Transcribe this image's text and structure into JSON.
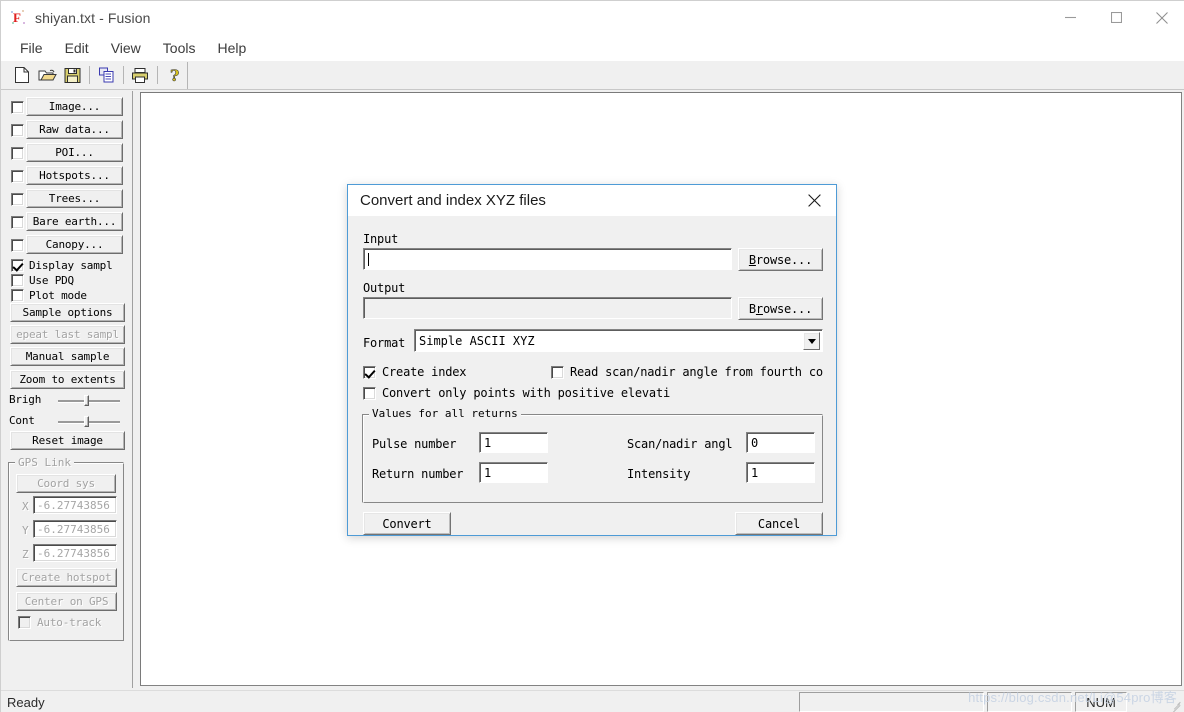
{
  "window": {
    "title": "shiyan.txt - Fusion",
    "icon": "fusion-app-icon",
    "controls": {
      "minimize": "minimize-icon",
      "maximize": "maximize-icon",
      "close": "close-icon"
    }
  },
  "menubar": {
    "items": [
      {
        "label": "File"
      },
      {
        "label": "Edit"
      },
      {
        "label": "View"
      },
      {
        "label": "Tools"
      },
      {
        "label": "Help"
      }
    ]
  },
  "toolbar": {
    "buttons": [
      {
        "icon": "new-file-icon",
        "title": "New"
      },
      {
        "icon": "open-folder-icon",
        "title": "Open"
      },
      {
        "icon": "save-floppy-icon",
        "title": "Save"
      },
      {
        "icon": "copy-icon",
        "title": "Copy"
      },
      {
        "icon": "print-icon",
        "title": "Print"
      },
      {
        "icon": "help-question-icon",
        "title": "About"
      }
    ]
  },
  "left_panel": {
    "layer_rows": [
      {
        "label": "Image...",
        "checked": false,
        "accel": "I"
      },
      {
        "label": "Raw data...",
        "checked": false,
        "accel": "d"
      },
      {
        "label": "POI...",
        "checked": false,
        "accel": "P"
      },
      {
        "label": "Hotspots...",
        "checked": false,
        "accel": "H"
      },
      {
        "label": "Trees...",
        "checked": false,
        "accel": "r"
      },
      {
        "label": "Bare earth...",
        "checked": false,
        "accel": "B"
      },
      {
        "label": "Canopy...",
        "checked": false,
        "accel": "C"
      }
    ],
    "checkboxes": [
      {
        "label": "Display sampl",
        "checked": true
      },
      {
        "label": "Use PDQ",
        "checked": false
      },
      {
        "label": "Plot mode",
        "checked": false
      }
    ],
    "buttons": [
      {
        "label": "Sample options",
        "disabled": false
      },
      {
        "label": "epeat last sampl",
        "disabled": true
      },
      {
        "label": "Manual sample",
        "disabled": false
      },
      {
        "label": "Zoom to extents",
        "disabled": false
      },
      {
        "label": "Reset image",
        "disabled": false
      }
    ],
    "sliders": [
      {
        "label": "Brigh",
        "value": 52
      },
      {
        "label": "Cont",
        "value": 52
      }
    ],
    "gps_group": {
      "title": "GPS Link",
      "coord_button": "Coord sys",
      "coords": [
        {
          "label": "X",
          "value": "-6.27743856"
        },
        {
          "label": "Y",
          "value": "-6.27743856"
        },
        {
          "label": "Z",
          "value": "-6.27743856"
        }
      ],
      "buttons": [
        {
          "label": "Create hotspot",
          "disabled": true
        },
        {
          "label": "Center on GPS",
          "disabled": true
        }
      ],
      "autotrack": {
        "label": "Auto-track",
        "checked": false,
        "disabled": true
      }
    }
  },
  "dialog": {
    "title": "Convert and index XYZ files",
    "close_icon": "close-icon",
    "input": {
      "label": "Input",
      "value": "",
      "browse": "Browse...",
      "browse_accel": "B"
    },
    "output": {
      "label": "Output",
      "value": "",
      "browse": "Browse...",
      "browse_accel": "r"
    },
    "format": {
      "label": "Format",
      "value": "Simple ASCII XYZ",
      "options": [
        "Simple ASCII XYZ"
      ]
    },
    "checkboxes": [
      {
        "label": "Create index",
        "checked": true
      },
      {
        "label": "Read scan/nadir angle from fourth co",
        "checked": false
      },
      {
        "label": "Convert only points with positive elevati",
        "checked": false
      }
    ],
    "values_group": {
      "title": "Values for all returns",
      "fields": [
        {
          "label": "Pulse number",
          "value": "1"
        },
        {
          "label": "Scan/nadir angl",
          "value": "0"
        },
        {
          "label": "Return number",
          "value": "1"
        },
        {
          "label": "Intensity",
          "value": "1"
        }
      ]
    },
    "actions": {
      "convert": "Convert",
      "cancel": "Cancel"
    }
  },
  "statusbar": {
    "message": "Ready",
    "cells": [
      {
        "label": ""
      },
      {
        "label": ""
      },
      {
        "label": "NUM"
      }
    ],
    "watermark": "https://blog.csdn.net/Li@54pro博客"
  }
}
